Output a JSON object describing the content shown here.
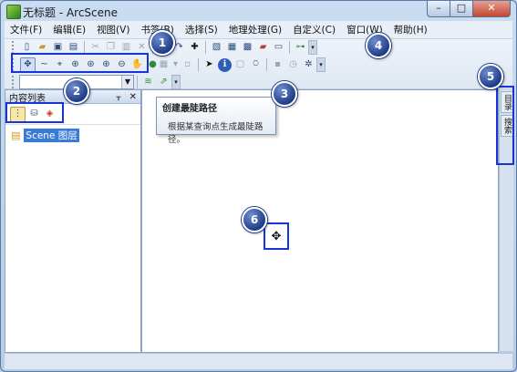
{
  "window": {
    "title": "无标题 - ArcScene",
    "min": "–",
    "max": "□",
    "close": "✕"
  },
  "menu": [
    "文件(F)",
    "编辑(E)",
    "视图(V)",
    "书签(B)",
    "选择(S)",
    "地理处理(G)",
    "自定义(C)",
    "窗口(W)",
    "帮助(H)"
  ],
  "toc": {
    "title": "内容列表",
    "pin": "ᚁ",
    "close": "✕",
    "layer": "Scene 图层"
  },
  "tooltip": {
    "title": "创建最陡路径",
    "description": "根据某查询点生成最陡路径。"
  },
  "right_dock": {
    "tab1": "目录",
    "tab2": "搜索"
  },
  "callouts": [
    "1",
    "2",
    "3",
    "4",
    "5",
    "6"
  ],
  "icons": {
    "navigate": "✥",
    "fly": "~",
    "center": "⌖",
    "zoom_target": "⊕",
    "zoom_in": "⊕",
    "zoom_out": "⊖",
    "pan": "✋",
    "full_extent": "●",
    "info": "ℹ",
    "binoculars": "⍥",
    "cursor": "✥"
  },
  "colors": {
    "callout": "#1f3d87",
    "highlight": "#1834d6",
    "selected_layer": "#3b7bd8"
  }
}
